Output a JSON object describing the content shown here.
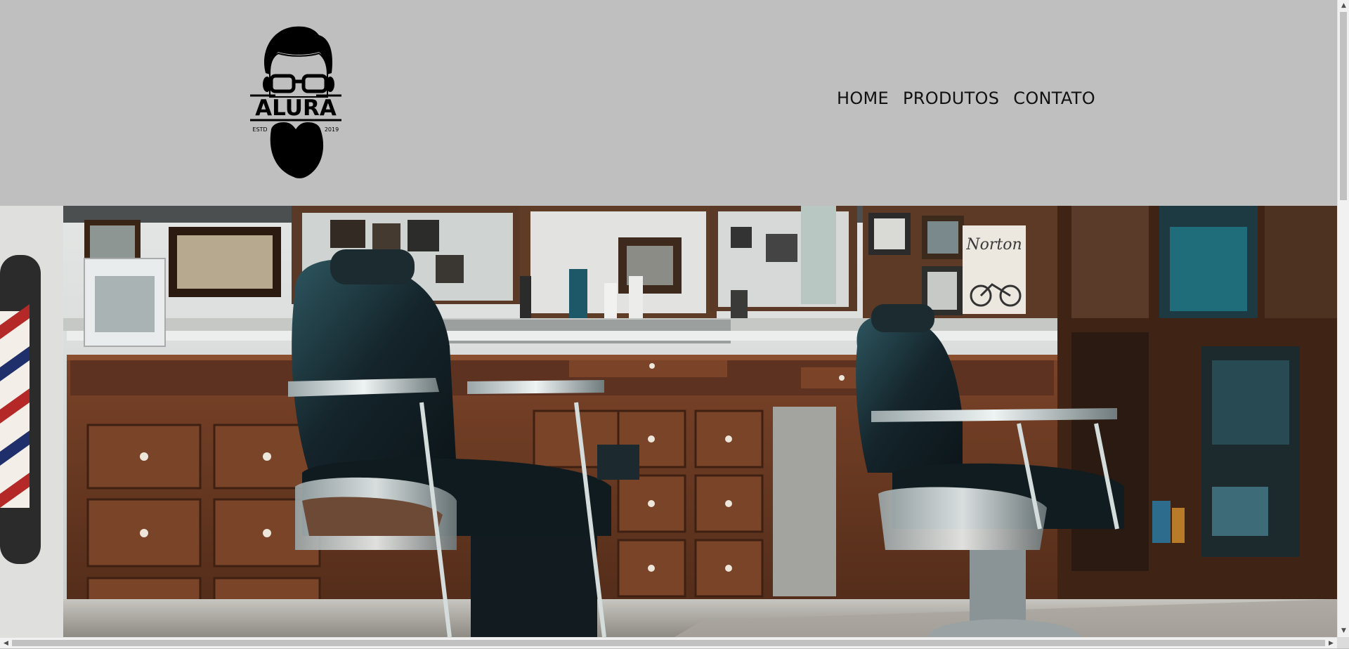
{
  "logo": {
    "brand": "ALURA",
    "left_tag": "ESTD",
    "right_tag": "2019"
  },
  "nav": {
    "items": [
      "HOME",
      "PRODUTOS",
      "CONTATO"
    ]
  },
  "hero": {
    "sign_text": "Norton"
  },
  "colors": {
    "header_bg": "#bfbfbf",
    "text": "#111111",
    "wood": "#6b3a22",
    "leather": "#1a2a2e",
    "teal": "#2b5a63"
  },
  "scrollbars": {
    "up": "▲",
    "down": "▼",
    "left": "◀",
    "right": "▶"
  }
}
